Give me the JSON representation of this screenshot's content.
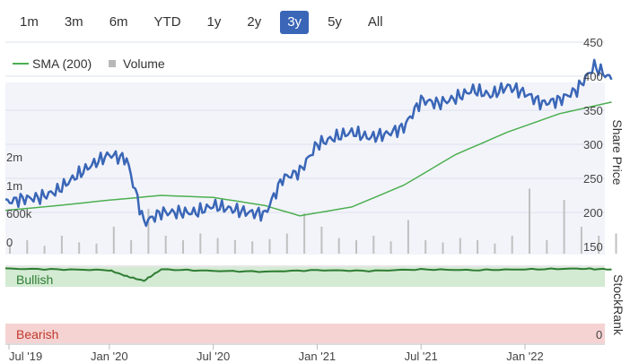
{
  "range_selector": {
    "buttons": [
      "1m",
      "3m",
      "6m",
      "YTD",
      "1y",
      "2y",
      "3y",
      "5y",
      "All"
    ],
    "active": "3y"
  },
  "chart_data": [
    {
      "type": "line",
      "title": "",
      "xlabel": "",
      "ylabel": "Share Price",
      "x_ticks": [
        "Jul '19",
        "Jan '20",
        "Jul '20",
        "Jan '21",
        "Jul '21",
        "Jan '22"
      ],
      "yticks_right": [
        150,
        200,
        250,
        300,
        350,
        400,
        450
      ],
      "ylim": [
        150,
        450
      ],
      "volume_ticks": [
        "0",
        "600k",
        "1m",
        "2m"
      ],
      "legend": [
        "SMA (200)",
        "Volume"
      ],
      "legend_position": "top-left",
      "colors": {
        "price": "#3a66b7",
        "sma": "#4caf50",
        "volume": "#c0c0c0"
      },
      "series": [
        {
          "name": "",
          "x": [
            "2019-07",
            "2019-08",
            "2019-09",
            "2019-10",
            "2019-11",
            "2019-12",
            "2020-01",
            "2020-02",
            "2020-03",
            "2020-04",
            "2020-05",
            "2020-06",
            "2020-07",
            "2020-08",
            "2020-09",
            "2020-10",
            "2020-11",
            "2020-12",
            "2021-01",
            "2021-02",
            "2021-03",
            "2021-04",
            "2021-05",
            "2021-06",
            "2021-07",
            "2021-08",
            "2021-09",
            "2021-10",
            "2021-11",
            "2021-12",
            "2022-01",
            "2022-02",
            "2022-03",
            "2022-04",
            "2022-05",
            "2022-06"
          ],
          "values": [
            215,
            220,
            222,
            232,
            252,
            270,
            285,
            278,
            185,
            200,
            200,
            200,
            210,
            205,
            200,
            198,
            250,
            260,
            300,
            310,
            318,
            310,
            315,
            325,
            365,
            360,
            368,
            380,
            372,
            385,
            375,
            360,
            365,
            380,
            415,
            395
          ]
        },
        {
          "name": "SMA (200)",
          "x": [
            "2019-07",
            "2019-10",
            "2020-01",
            "2020-04",
            "2020-07",
            "2020-10",
            "2020-12",
            "2021-03",
            "2021-06",
            "2021-09",
            "2021-12",
            "2022-03",
            "2022-06"
          ],
          "values": [
            203,
            210,
            218,
            225,
            222,
            210,
            195,
            208,
            240,
            285,
            318,
            345,
            362
          ]
        }
      ],
      "volume": [
        40,
        60,
        35,
        80,
        50,
        45,
        120,
        60,
        200,
        80,
        60,
        90,
        70,
        60,
        55,
        65,
        90,
        180,
        120,
        70,
        60,
        80,
        55,
        150,
        60,
        50,
        70,
        60,
        45,
        80,
        290,
        60,
        240,
        120,
        80,
        90
      ]
    },
    {
      "type": "area",
      "ylabel": "StockRank",
      "zones": [
        "Bullish",
        "Bearish"
      ],
      "ytick_bottom": "0",
      "colors": {
        "rank": "#2e7d32",
        "bullish": "#d3ead3",
        "bearish": "#f6d3d3",
        "bearish_text": "#c0392b"
      },
      "x": [
        "2019-07",
        "2019-10",
        "2020-01",
        "2020-02",
        "2020-03",
        "2020-04",
        "2020-07",
        "2020-10",
        "2021-01",
        "2021-04",
        "2021-07",
        "2021-10",
        "2022-01",
        "2022-04",
        "2022-06"
      ],
      "values": [
        98,
        97,
        96,
        88,
        82,
        97,
        95,
        94,
        96,
        95,
        97,
        96,
        97,
        98,
        97
      ],
      "zone_thresholds": {
        "bullish_min": 90
      }
    }
  ]
}
